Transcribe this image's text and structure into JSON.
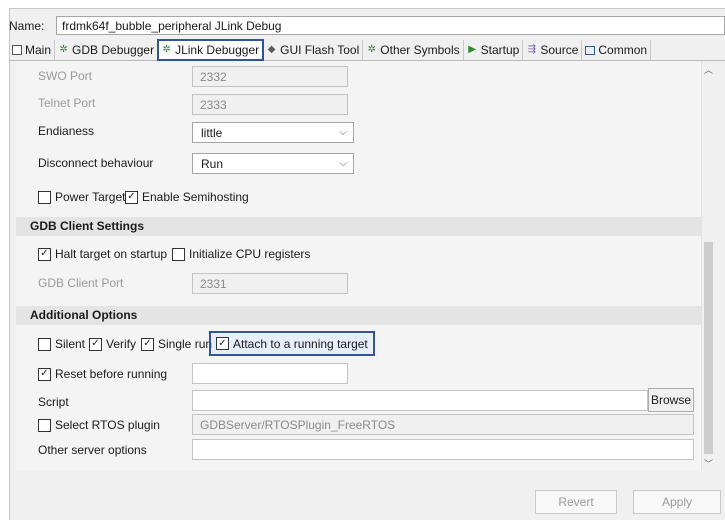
{
  "name": {
    "label": "Name:",
    "value": "frdmk64f_bubble_peripheral JLink Debug"
  },
  "tabs": [
    {
      "label": "Main",
      "icon": "main-tab-icon"
    },
    {
      "label": "GDB Debugger",
      "icon": "gdb-debugger-icon"
    },
    {
      "label": "JLink Debugger",
      "icon": "jlink-debugger-icon"
    },
    {
      "label": "GUI Flash Tool",
      "icon": "gui-flash-icon"
    },
    {
      "label": "Other Symbols",
      "icon": "other-symbols-icon"
    },
    {
      "label": "Startup",
      "icon": "startup-icon"
    },
    {
      "label": "Source",
      "icon": "source-icon"
    },
    {
      "label": "Common",
      "icon": "common-icon"
    }
  ],
  "server": {
    "swo_port_label": "SWO Port",
    "swo_port_value": "2332",
    "telnet_port_label": "Telnet Port",
    "telnet_port_value": "2333",
    "endianess_label": "Endianess",
    "endianess_value": "little",
    "disconnect_label": "Disconnect behaviour",
    "disconnect_value": "Run",
    "power_target_label": "Power Target",
    "enable_semihosting_label": "Enable Semihosting"
  },
  "gdb_client": {
    "title": "GDB Client Settings",
    "halt_label": "Halt target on startup",
    "init_cpu_label": "Initialize CPU registers",
    "port_label": "GDB Client Port",
    "port_value": "2331"
  },
  "additional": {
    "title": "Additional Options",
    "silent_label": "Silent",
    "verify_label": "Verify",
    "single_run_label": "Single run",
    "attach_label": "Attach to a running target",
    "reset_label": "Reset before running",
    "reset_value": "",
    "script_label": "Script",
    "script_value": "",
    "browse_label": "Browse",
    "rtos_label": "Select RTOS plugin",
    "rtos_value": "GDBServer/RTOSPlugin_FreeRTOS",
    "other_label": "Other server options",
    "other_value": ""
  },
  "buttons": {
    "revert_label": "Revert",
    "apply_label": "Apply"
  },
  "colors": {
    "highlight": "#2f5597",
    "panel": "#f4f4f4"
  }
}
